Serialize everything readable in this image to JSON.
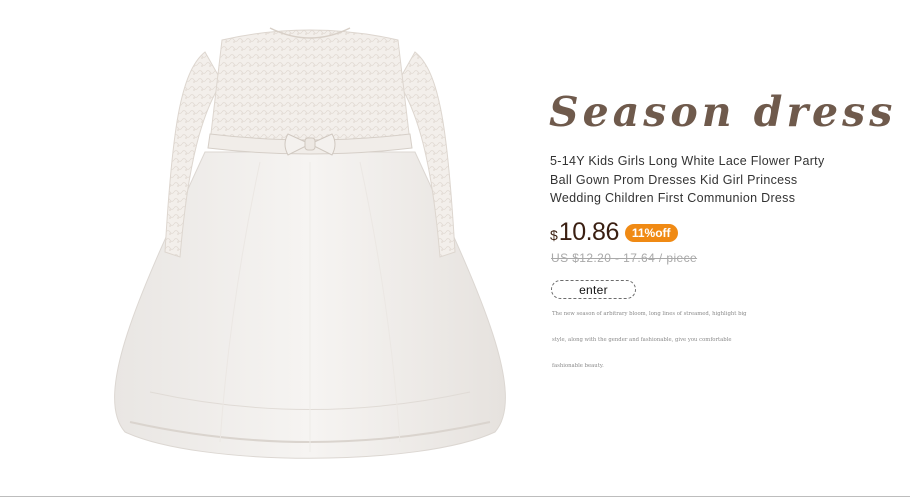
{
  "headline": "Season dress",
  "product": {
    "title_lines": [
      "5-14Y Kids Girls Long White Lace Flower Party",
      "Ball Gown Prom Dresses Kid Girl Princess",
      "Wedding Children First Communion Dress"
    ],
    "currency": "$",
    "price": "10.86",
    "discount_badge": "11%off",
    "original_price": "US $12.20 - 17.64 / piece"
  },
  "enter_button": "enter",
  "description_lines": [
    "The new season of arbitrary bloom, long lines of streamed, highlight big",
    "style, along with the gender and fashionable, give you comfortable",
    "fashionable beauty."
  ],
  "colors": {
    "headline": "#6f5a4c",
    "badge": "#f08a14",
    "price": "#3a1f12",
    "dress": "#f4f1ee"
  },
  "image": {
    "subject": "white-lace-long-sleeve-girls-ball-gown"
  }
}
